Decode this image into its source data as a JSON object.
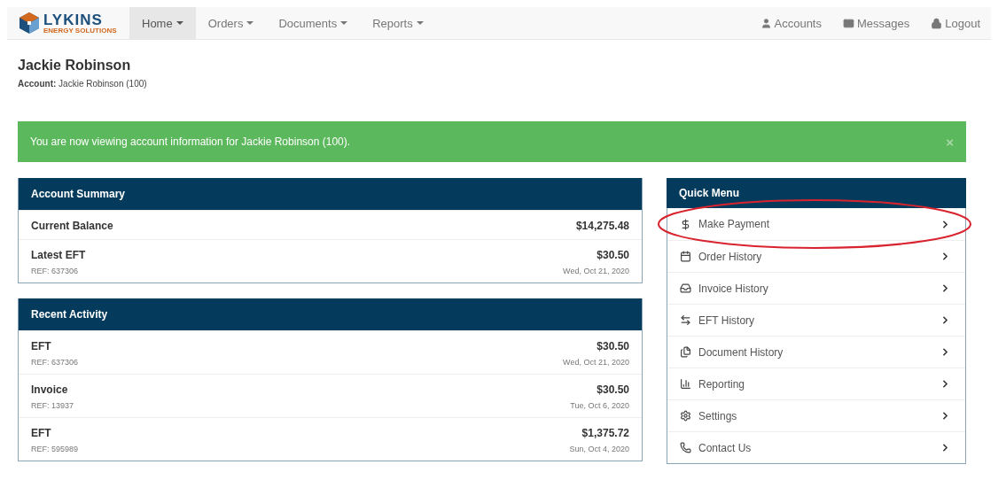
{
  "brand": {
    "name": "LYKINS",
    "tagline": "ENERGY SOLUTIONS"
  },
  "nav": [
    {
      "label": "Home",
      "selected": true
    },
    {
      "label": "Orders",
      "selected": false
    },
    {
      "label": "Documents",
      "selected": false
    },
    {
      "label": "Reports",
      "selected": false
    }
  ],
  "nav_right": [
    {
      "label": "Accounts"
    },
    {
      "label": "Messages"
    },
    {
      "label": "Logout"
    }
  ],
  "page_title": "Jackie Robinson",
  "account_line": "**Account:** Jackie Robinson (100)",
  "alert": {
    "text": "You are now viewing account information for Jackie Robinson (100).",
    "close": "×"
  },
  "account_summary": {
    "title": "Account Summary",
    "rows": [
      {
        "label": "Current Balance",
        "amount": "$14,275.48"
      },
      {
        "label": "Latest EFT",
        "amount": "$30.50",
        "ref": "REF: 637306",
        "date": "Wed, Oct 21, 2020"
      }
    ]
  },
  "recent_activity": {
    "title": "Recent Activity",
    "rows": [
      {
        "label": "EFT",
        "amount": "$30.50",
        "ref": "REF: 637306",
        "date": "Wed, Oct 21, 2020"
      },
      {
        "label": "Invoice",
        "amount": "$30.50",
        "ref": "REF: 13937",
        "date": "Tue, Oct 6, 2020"
      },
      {
        "label": "EFT",
        "amount": "$1,375.72",
        "ref": "REF: 595989",
        "date": "Sun, Oct 4, 2020"
      }
    ]
  },
  "quick_menu": {
    "title": "Quick Menu",
    "items": [
      {
        "label": "Make Payment",
        "circled": true
      },
      {
        "label": "Order History",
        "circled": false
      },
      {
        "label": "Invoice History",
        "circled": false
      },
      {
        "label": "EFT History",
        "circled": false
      },
      {
        "label": "Document History",
        "circled": false
      },
      {
        "label": "Reporting",
        "circled": false
      },
      {
        "label": "Settings",
        "circled": false
      },
      {
        "label": "Contact Us",
        "circled": false
      }
    ]
  }
}
